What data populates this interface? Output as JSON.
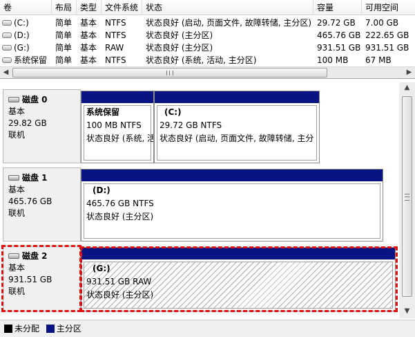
{
  "volume_table": {
    "headers": [
      "卷",
      "布局",
      "类型",
      "文件系统",
      "状态",
      "容量",
      "可用空间"
    ],
    "rows": [
      [
        "(C:)",
        "简单",
        "基本",
        "NTFS",
        "状态良好 (启动, 页面文件, 故障转储, 主分区)",
        "29.72 GB",
        "7.00 GB"
      ],
      [
        "(D:)",
        "简单",
        "基本",
        "NTFS",
        "状态良好 (主分区)",
        "465.76 GB",
        "222.65 GB"
      ],
      [
        "(G:)",
        "简单",
        "基本",
        "RAW",
        "状态良好 (主分区)",
        "931.51 GB",
        "931.51 GB"
      ],
      [
        "系统保留",
        "简单",
        "基本",
        "NTFS",
        "状态良好 (系统, 活动, 主分区)",
        "100 MB",
        "67 MB"
      ]
    ],
    "scroll_left": "◀",
    "scroll_right": "▶"
  },
  "disks": [
    {
      "name": "磁盘 0",
      "type": "基本",
      "size": "29.82 GB",
      "status": "联机",
      "partitions": [
        {
          "name": "系统保留",
          "size_fs": "100 MB NTFS",
          "status": "状态良好 (系统, 活"
        },
        {
          "name": "(C:)",
          "size_fs": "29.72 GB NTFS",
          "status": "状态良好 (启动, 页面文件, 故障转储, 主分"
        }
      ]
    },
    {
      "name": "磁盘 1",
      "type": "基本",
      "size": "465.76 GB",
      "status": "联机",
      "partitions": [
        {
          "name": "(D:)",
          "size_fs": "465.76 GB NTFS",
          "status": "状态良好 (主分区)"
        }
      ]
    },
    {
      "name": "磁盘 2",
      "type": "基本",
      "size": "931.51 GB",
      "status": "联机",
      "partitions": [
        {
          "name": "(G:)",
          "size_fs": "931.51 GB RAW",
          "status": "状态良好 (主分区)"
        }
      ]
    }
  ],
  "vscroll": {
    "up": "▲",
    "down": "▼"
  },
  "legend": {
    "unallocated": "未分配",
    "primary": "主分区",
    "unallocated_color": "#000000",
    "primary_color": "#0a1384"
  },
  "colors": {
    "partition_bar": "#0a1384",
    "selection_outline": "#e10f0f"
  }
}
